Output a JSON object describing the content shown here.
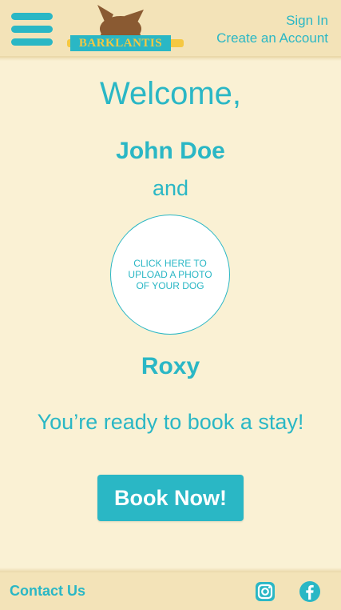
{
  "header": {
    "logo_text": "BARKLANTIS",
    "sign_in_label": "Sign In",
    "create_account_label": "Create an Account",
    "menu_icon": "hamburger-menu-icon"
  },
  "main": {
    "welcome": "Welcome,",
    "owner_name": "John Doe",
    "and": "and",
    "upload_prompt": "CLICK HERE TO UPLOAD A PHOTO OF YOUR DOG",
    "dog_name": "Roxy",
    "ready_message": "You’re ready to book a stay!",
    "book_button_label": "Book Now!"
  },
  "footer": {
    "contact_label": "Contact Us",
    "social_icons": [
      "instagram-icon",
      "facebook-icon"
    ]
  },
  "colors": {
    "accent": "#2ab7c5",
    "background": "#faf1d4",
    "header_footer": "#f3e3b8",
    "logo_text": "#f5c842",
    "logo_dog": "#8a5a32"
  }
}
